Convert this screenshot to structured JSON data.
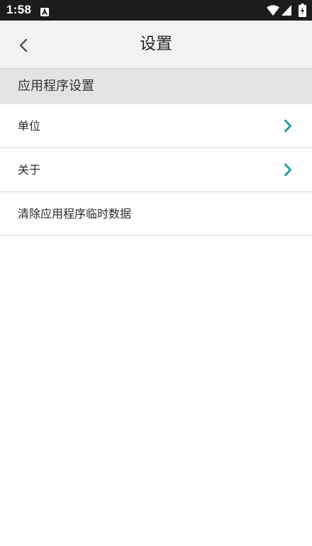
{
  "status_bar": {
    "time": "1:58",
    "app_icon": "a-letter-icon",
    "icons": [
      "wifi-icon",
      "signal-icon",
      "battery-icon"
    ]
  },
  "app_bar": {
    "title": "设置",
    "back_icon": "chevron-left-icon"
  },
  "section": {
    "title": "应用程序设置"
  },
  "items": [
    {
      "label": "单位",
      "has_chevron": true
    },
    {
      "label": "关于",
      "has_chevron": true
    },
    {
      "label": "清除应用程序临时数据",
      "has_chevron": false
    }
  ],
  "colors": {
    "status_bar": "#1c1c1c",
    "app_bar": "#f2f2f2",
    "section_header": "#e3e3e3",
    "accent_chevron": "#1e9aa0"
  }
}
